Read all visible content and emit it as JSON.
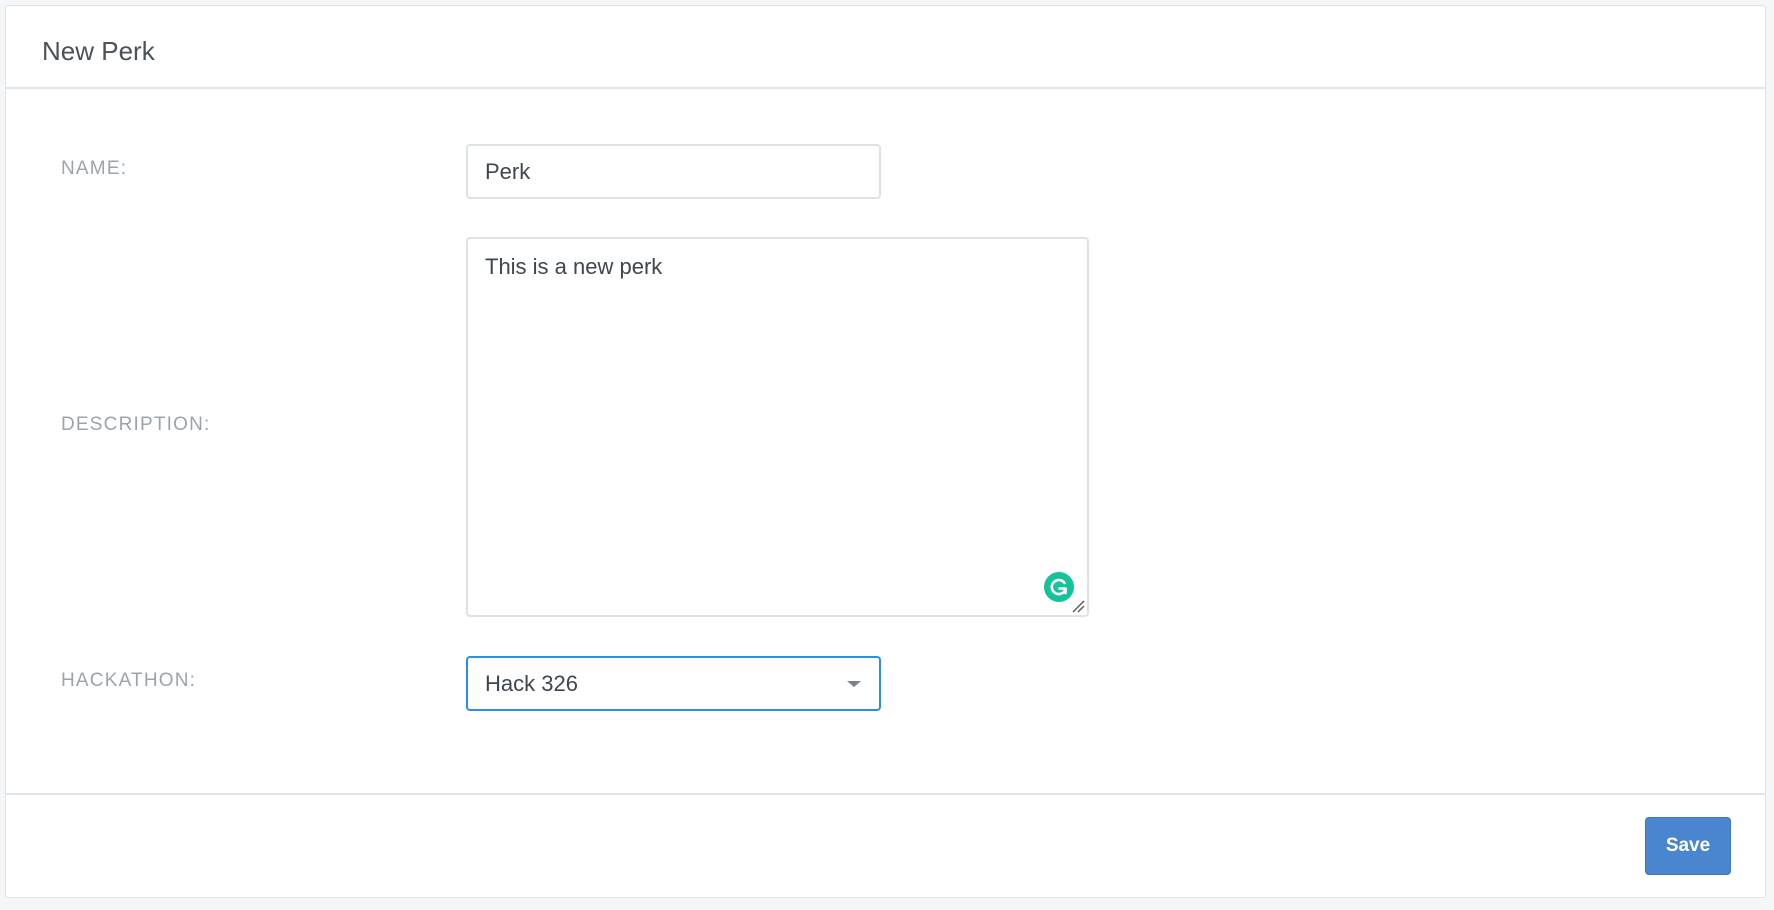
{
  "header": {
    "title": "New Perk"
  },
  "form": {
    "name": {
      "label": "NAME:",
      "value": "Perk"
    },
    "description": {
      "label": "DESCRIPTION:",
      "value": "This is a new perk"
    },
    "hackathon": {
      "label": "HACKATHON:",
      "selected": "Hack 326"
    }
  },
  "footer": {
    "save_label": "Save"
  },
  "icons": {
    "grammarly": "grammarly-icon",
    "resize": "resize-handle-icon",
    "caret": "chevron-down-icon"
  },
  "colors": {
    "accent": "#4a86d0",
    "focus_border": "#2b8fe8",
    "grammarly": "#15c39a"
  }
}
